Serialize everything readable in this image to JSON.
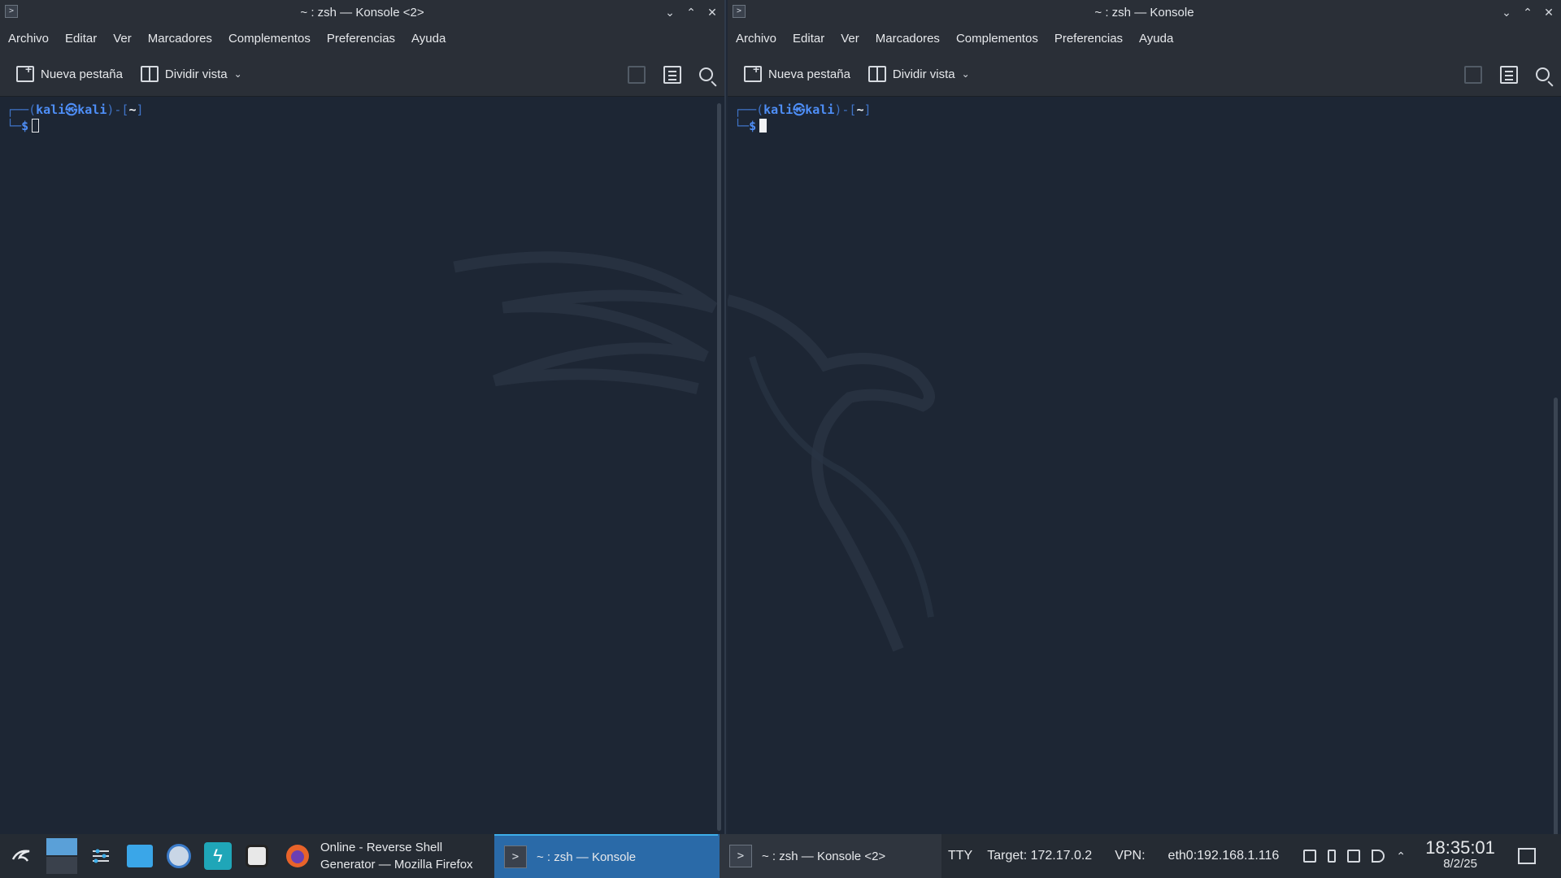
{
  "colors": {
    "accent": "#3daee9",
    "prompt_blue": "#4e8ef7",
    "terminal_bg": "#1d2634",
    "taskbar_bg": "#252b33"
  },
  "left_window": {
    "title": "~ : zsh — Konsole <2>",
    "menu": [
      "Archivo",
      "Editar",
      "Ver",
      "Marcadores",
      "Complementos",
      "Preferencias",
      "Ayuda"
    ],
    "toolbar": {
      "new_tab": "Nueva pestaña",
      "split_view": "Dividir vista"
    },
    "prompt": {
      "frame_open": "┌──(",
      "user": "kali㉿kali",
      "frame_mid": ")-[",
      "dir": "~",
      "frame_close": "]",
      "line2_frame": "└─",
      "dollar": "$"
    }
  },
  "right_window": {
    "title": "~ : zsh — Konsole",
    "menu": [
      "Archivo",
      "Editar",
      "Ver",
      "Marcadores",
      "Complementos",
      "Preferencias",
      "Ayuda"
    ],
    "toolbar": {
      "new_tab": "Nueva pestaña",
      "split_view": "Dividir vista"
    },
    "prompt": {
      "frame_open": "┌──(",
      "user": "kali㉿kali",
      "frame_mid": ")-[",
      "dir": "~",
      "frame_close": "]",
      "line2_frame": "└─",
      "dollar": "$"
    }
  },
  "taskbar": {
    "tasks": [
      {
        "label_line1": "Online - Reverse Shell",
        "label_line2": "Generator — Mozilla Firefox"
      },
      {
        "label": "~ : zsh — Konsole"
      },
      {
        "label": "~ : zsh — Konsole <2>"
      }
    ],
    "tty": "TTY",
    "target": "Target: 172.17.0.2",
    "vpn": "VPN:",
    "eth": "eth0:192.168.1.116",
    "time": "18:35:01",
    "date": "8/2/25"
  }
}
